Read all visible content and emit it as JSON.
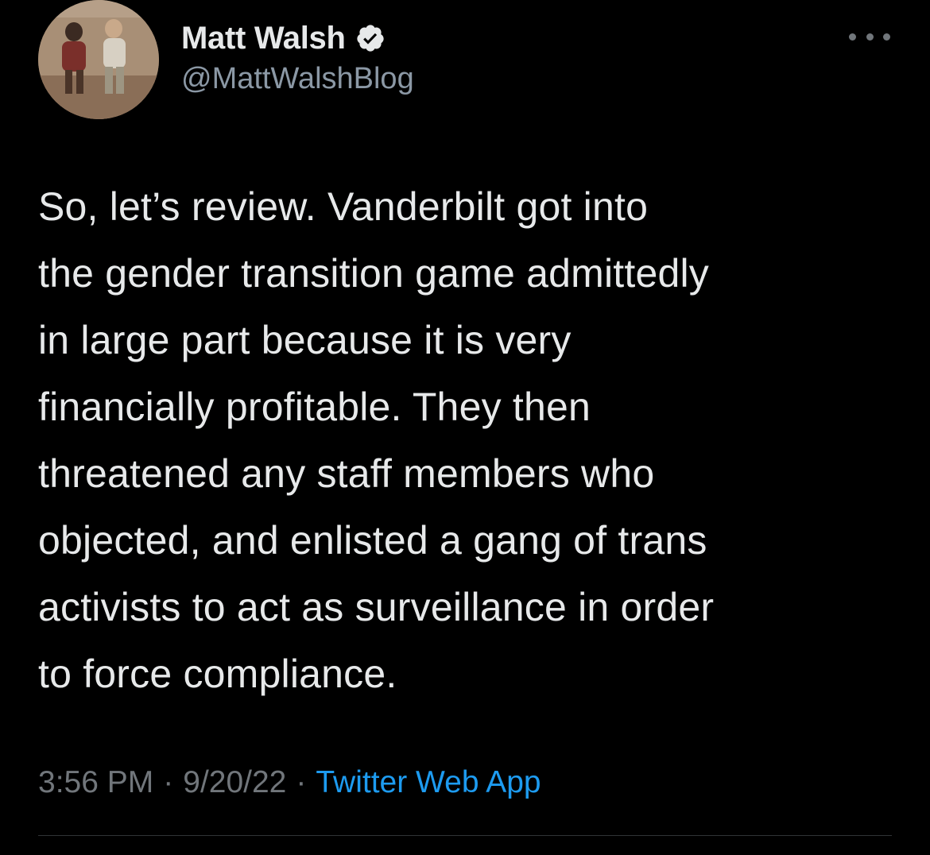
{
  "tweet": {
    "author": {
      "display_name": "Matt Walsh",
      "handle": "@MattWalshBlog",
      "verified": true,
      "avatar_icon": "profile-photo"
    },
    "more_icon": "ellipsis-icon",
    "text": "So, let’s review. Vanderbilt got into\nthe gender transition game admittedly\nin large part because it is very\nfinancially profitable. They then\nthreatened any staff members who\nobjected, and enlisted a gang of trans\nactivists to act as surveillance in order\nto force compliance.",
    "time": "3:56 PM",
    "date": "9/20/22",
    "separator": "·",
    "source": "Twitter Web App"
  },
  "colors": {
    "background": "#000000",
    "primary_text": "#e7e9ea",
    "secondary_text": "#71767b",
    "link": "#1d9bf0",
    "divider": "#2f3336"
  }
}
